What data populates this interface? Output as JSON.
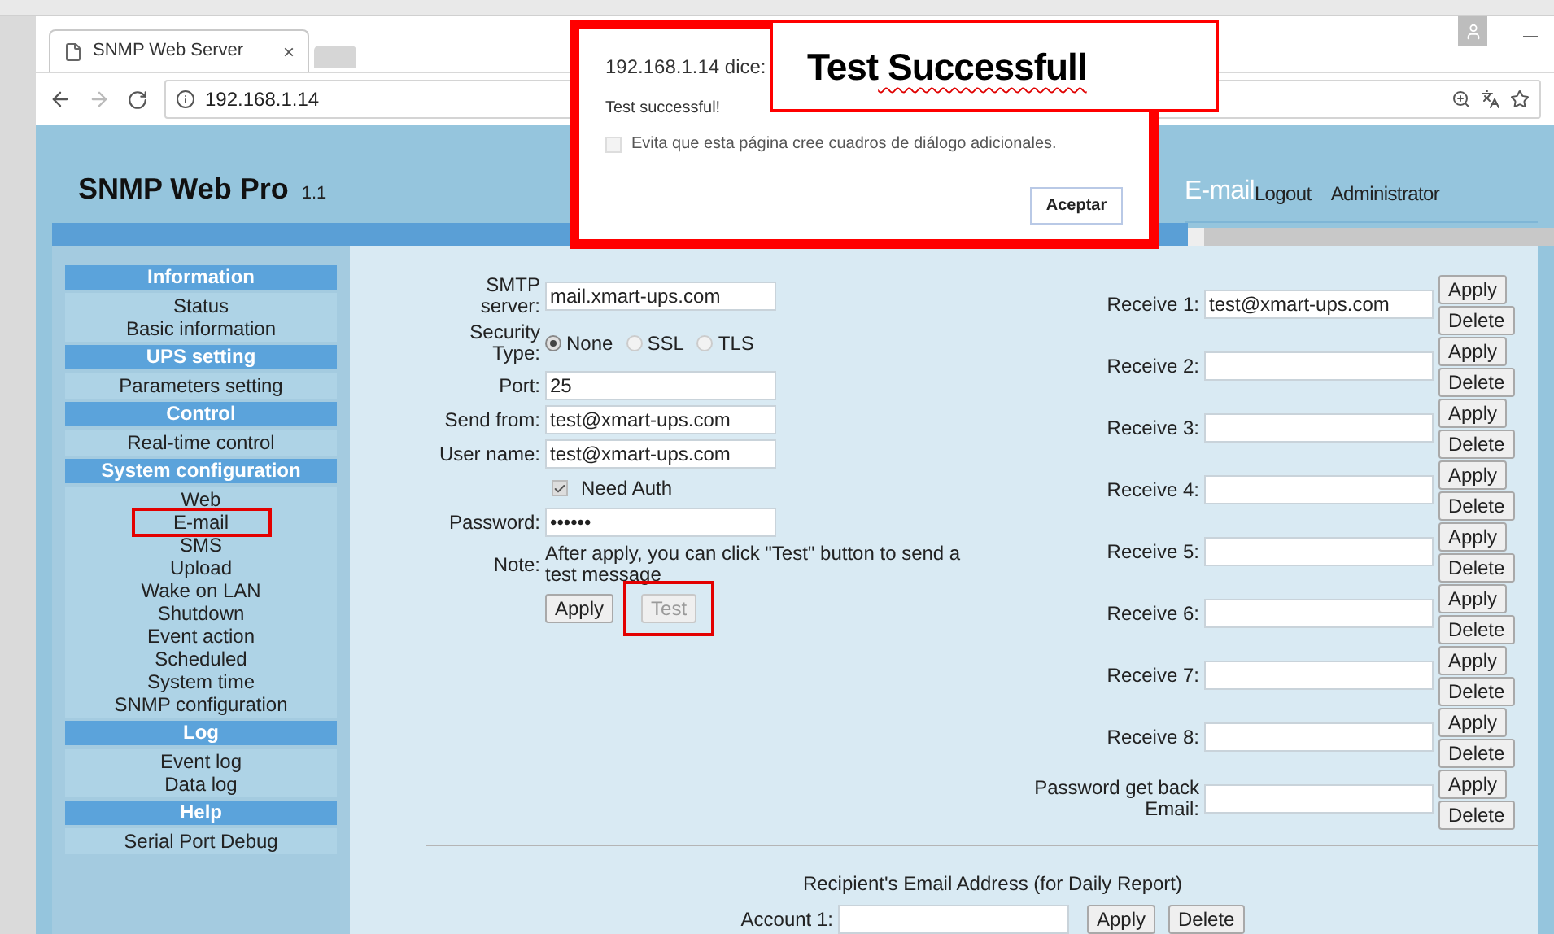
{
  "browser": {
    "tab": {
      "title": "SNMP Web Server",
      "close": "×"
    },
    "address": "192.168.1.14"
  },
  "header": {
    "title": "SNMP Web Pro",
    "version": "1.1",
    "page": "E-mail",
    "links": [
      "Logout",
      "Administrator"
    ]
  },
  "sidebar": [
    {
      "title": "Information",
      "items": [
        {
          "label": "Status",
          "annotated": false
        },
        {
          "label": "Basic information",
          "annotated": false
        }
      ]
    },
    {
      "title": "UPS setting",
      "items": [
        {
          "label": "Parameters setting",
          "annotated": false
        }
      ]
    },
    {
      "title": "Control",
      "items": [
        {
          "label": "Real-time control",
          "annotated": false
        }
      ]
    },
    {
      "title": "System configuration",
      "items": [
        {
          "label": "Web",
          "annotated": false
        },
        {
          "label": "E-mail",
          "annotated": true
        },
        {
          "label": "SMS",
          "annotated": false
        },
        {
          "label": "Upload",
          "annotated": false
        },
        {
          "label": "Wake on LAN",
          "annotated": false
        },
        {
          "label": "Shutdown",
          "annotated": false
        },
        {
          "label": "Event action",
          "annotated": false
        },
        {
          "label": "Scheduled",
          "annotated": false
        },
        {
          "label": "System time",
          "annotated": false
        },
        {
          "label": "SNMP configuration",
          "annotated": false
        }
      ]
    },
    {
      "title": "Log",
      "items": [
        {
          "label": "Event log",
          "annotated": false
        },
        {
          "label": "Data log",
          "annotated": false
        }
      ]
    },
    {
      "title": "Help",
      "items": [
        {
          "label": "Serial Port Debug",
          "annotated": false
        }
      ]
    }
  ],
  "form": {
    "rows": [
      {
        "kind": "text",
        "label": "SMTP server:",
        "value": "mail.xmart-ups.com"
      },
      {
        "kind": "radio",
        "label": "Security Type:",
        "options": [
          {
            "label": "None",
            "selected": true
          },
          {
            "label": "SSL",
            "selected": false
          },
          {
            "label": "TLS",
            "selected": false
          }
        ]
      },
      {
        "kind": "text",
        "label": "Port:",
        "value": "25"
      },
      {
        "kind": "text",
        "label": "Send from:",
        "value": "test@xmart-ups.com"
      },
      {
        "kind": "text",
        "label": "User name:",
        "value": "test@xmart-ups.com"
      },
      {
        "kind": "checkbox",
        "label": "Need Auth",
        "checked": true
      },
      {
        "kind": "text",
        "label": "Password:",
        "value": "••••••"
      },
      {
        "kind": "note",
        "label": "Note:",
        "text": "After apply, you can click \"Test\" button to send a test message"
      }
    ],
    "buttons": [
      {
        "label": "Apply",
        "disabled": false,
        "annotated": false
      },
      {
        "label": "Test",
        "disabled": true,
        "annotated": true
      }
    ]
  },
  "receivers": [
    {
      "label": "Receive 1:",
      "value": "test@xmart-ups.com",
      "apply": "Apply",
      "delete": "Delete"
    },
    {
      "label": "Receive 2:",
      "apply": "Apply",
      "delete": "Delete"
    },
    {
      "label": "Receive 3:",
      "apply": "Apply",
      "delete": "Delete"
    },
    {
      "label": "Receive 4:",
      "apply": "Apply",
      "delete": "Delete"
    },
    {
      "label": "Receive 5:",
      "apply": "Apply",
      "delete": "Delete"
    },
    {
      "label": "Receive 6:",
      "apply": "Apply",
      "delete": "Delete"
    },
    {
      "label": "Receive 7:",
      "apply": "Apply",
      "delete": "Delete"
    },
    {
      "label": "Receive 8:",
      "apply": "Apply",
      "delete": "Delete"
    },
    {
      "label": "Password get back Email:",
      "apply": "Apply",
      "delete": "Delete"
    }
  ],
  "daily_report": {
    "title": "Recipient's Email Address (for Daily Report)",
    "account_label": "Account 1:",
    "apply": "Apply",
    "delete": "Delete"
  },
  "dialog": {
    "origin": "192.168.1.14 dice:",
    "message": "Test successful!",
    "option": {
      "label": "Evita que esta página cree cuadros de diálogo adicionales.",
      "checked": false
    },
    "button": "Aceptar"
  },
  "callout": {
    "words": [
      {
        "text": "Test",
        "misspelled": false
      },
      {
        "text": "Successfull",
        "misspelled": true
      }
    ]
  }
}
